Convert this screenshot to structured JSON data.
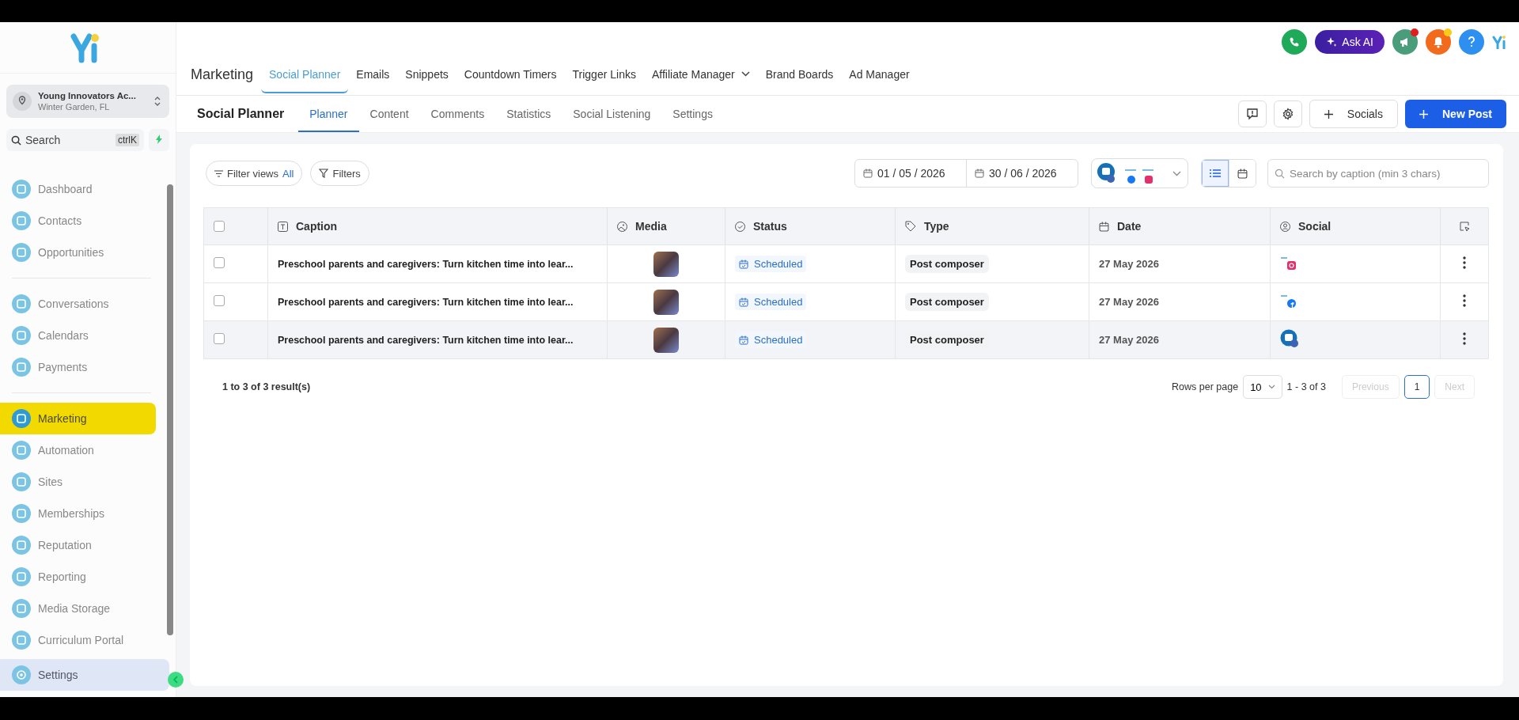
{
  "sidebar": {
    "account": {
      "name": "Young Innovators Ac...",
      "location": "Winter Garden, FL"
    },
    "search": {
      "placeholder": "Search",
      "shortcut": "ctrlK"
    },
    "groups": [
      [
        {
          "label": "Dashboard",
          "selected": false
        },
        {
          "label": "Contacts",
          "selected": false
        },
        {
          "label": "Opportunities",
          "selected": false
        }
      ],
      [
        {
          "label": "Conversations",
          "selected": false
        },
        {
          "label": "Calendars",
          "selected": false
        },
        {
          "label": "Payments",
          "selected": false
        }
      ],
      [
        {
          "label": "Marketing",
          "selected": true
        },
        {
          "label": "Automation",
          "selected": false
        },
        {
          "label": "Sites",
          "selected": false
        },
        {
          "label": "Memberships",
          "selected": false
        },
        {
          "label": "Reputation",
          "selected": false
        },
        {
          "label": "Reporting",
          "selected": false
        },
        {
          "label": "Media Storage",
          "selected": false
        },
        {
          "label": "Curriculum Portal",
          "selected": false
        }
      ]
    ],
    "footer_item": {
      "label": "Settings",
      "selected": true
    }
  },
  "header_icons": [
    {
      "kind": "phone"
    },
    {
      "kind": "ask-ai",
      "label": "Ask AI"
    },
    {
      "kind": "megaphone",
      "badge": true
    },
    {
      "kind": "bell",
      "badge": true
    },
    {
      "kind": "help"
    },
    {
      "kind": "logo"
    }
  ],
  "module": {
    "title": "Marketing",
    "tabs": [
      {
        "label": "Social Planner",
        "selected": true,
        "has_menu": false
      },
      {
        "label": "Emails",
        "selected": false,
        "has_menu": false
      },
      {
        "label": "Snippets",
        "selected": false,
        "has_menu": false
      },
      {
        "label": "Countdown Timers",
        "selected": false,
        "has_menu": false
      },
      {
        "label": "Trigger Links",
        "selected": false,
        "has_menu": false
      },
      {
        "label": "Affiliate Manager",
        "selected": false,
        "has_menu": true
      },
      {
        "label": "Brand Boards",
        "selected": false,
        "has_menu": false
      },
      {
        "label": "Ad Manager",
        "selected": false,
        "has_menu": false
      }
    ]
  },
  "subnav": {
    "title": "Social Planner",
    "tabs": [
      {
        "label": "Planner",
        "selected": true
      },
      {
        "label": "Content",
        "selected": false
      },
      {
        "label": "Comments",
        "selected": false
      },
      {
        "label": "Statistics",
        "selected": false
      },
      {
        "label": "Social Listening",
        "selected": false
      },
      {
        "label": "Settings",
        "selected": false
      }
    ],
    "socials_button": "Socials",
    "new_post_button": "New Post"
  },
  "toolbar": {
    "filter_views": {
      "label": "Filter views",
      "value": "All"
    },
    "filters": "Filters",
    "date_from": "01 / 05 / 2026",
    "date_to": "30 / 06 / 2026",
    "views": [
      {
        "kind": "list",
        "selected": true
      },
      {
        "kind": "calendar",
        "selected": false
      }
    ],
    "search": {
      "placeholder": "Search by caption (min 3 chars)"
    }
  },
  "table": {
    "select_all_checked": false,
    "columns": [
      {
        "kind": "check"
      },
      {
        "kind": "caption",
        "label": "Caption"
      },
      {
        "kind": "media",
        "label": "Media"
      },
      {
        "kind": "status",
        "label": "Status"
      },
      {
        "kind": "type",
        "label": "Type"
      },
      {
        "kind": "date",
        "label": "Date"
      },
      {
        "kind": "social",
        "label": "Social"
      },
      {
        "kind": "actions"
      }
    ],
    "rows": [
      {
        "checked": false,
        "highlighted": false,
        "caption": "Preschool parents and caregivers: Turn kitchen time into lear...",
        "status": "Scheduled",
        "type": "Post composer",
        "date": "27 May 2026",
        "social": {
          "kind": "instagram"
        }
      },
      {
        "checked": false,
        "highlighted": false,
        "caption": "Preschool parents and caregivers: Turn kitchen time into lear...",
        "status": "Scheduled",
        "type": "Post composer",
        "date": "27 May 2026",
        "social": {
          "kind": "facebook"
        }
      },
      {
        "checked": false,
        "highlighted": true,
        "caption": "Preschool parents and caregivers: Turn kitchen time into lear...",
        "status": "Scheduled",
        "type": "Post composer",
        "date": "27 May 2026",
        "social": {
          "kind": "business"
        }
      }
    ]
  },
  "pagination": {
    "summary": "1 to 3 of 3 result(s)",
    "rows_per_page_label": "Rows per page",
    "rows_per_page": "10",
    "range": "1 - 3 of 3",
    "previous": {
      "label": "Previous",
      "disabled": true
    },
    "pages": [
      {
        "label": "1",
        "selected": true
      }
    ],
    "next": {
      "label": "Next",
      "disabled": true
    }
  }
}
